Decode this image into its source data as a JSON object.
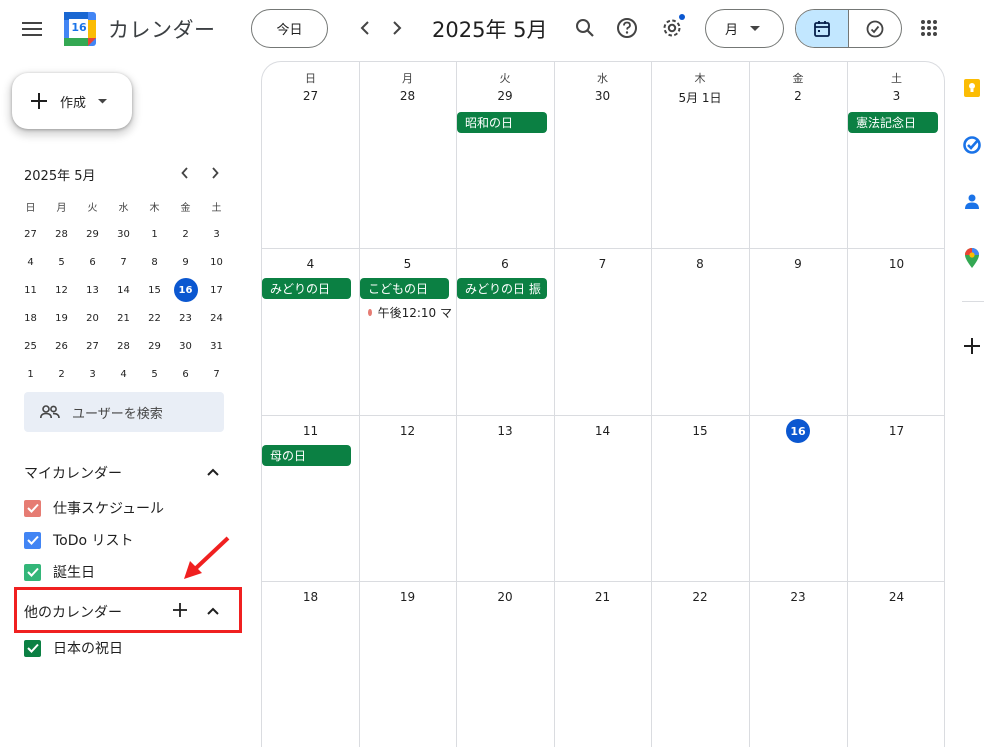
{
  "header": {
    "app_title": "カレンダー",
    "logo_number": "16",
    "today_label": "今日",
    "month_title": "2025年 5月",
    "view_label": "月",
    "colors": {
      "accent": "#0b57d0",
      "toggle_bg": "#c2e7ff"
    }
  },
  "sidebar": {
    "create_label": "作成",
    "mini_calendar": {
      "title": "2025年 5月",
      "weekdays": [
        "日",
        "月",
        "火",
        "水",
        "木",
        "金",
        "土"
      ],
      "weeks": [
        [
          "27",
          "28",
          "29",
          "30",
          "1",
          "2",
          "3"
        ],
        [
          "4",
          "5",
          "6",
          "7",
          "8",
          "9",
          "10"
        ],
        [
          "11",
          "12",
          "13",
          "14",
          "15",
          "16",
          "17"
        ],
        [
          "18",
          "19",
          "20",
          "21",
          "22",
          "23",
          "24"
        ],
        [
          "25",
          "26",
          "27",
          "28",
          "29",
          "30",
          "31"
        ],
        [
          "1",
          "2",
          "3",
          "4",
          "5",
          "6",
          "7"
        ]
      ],
      "today": "16"
    },
    "user_search_label": "ユーザーを検索",
    "my_calendars_title": "マイカレンダー",
    "my_calendars": [
      {
        "label": "仕事スケジュール",
        "color": "#e67c73"
      },
      {
        "label": "ToDo リスト",
        "color": "#4285f4"
      },
      {
        "label": "誕生日",
        "color": "#33b679"
      }
    ],
    "other_calendars_title": "他のカレンダー",
    "other_calendars": [
      {
        "label": "日本の祝日",
        "color": "#0b8043"
      }
    ]
  },
  "grid": {
    "weekdays": [
      "日",
      "月",
      "火",
      "水",
      "木",
      "金",
      "土"
    ],
    "weeks": [
      [
        "27",
        "28",
        "29",
        "30",
        "5月 1日",
        "2",
        "3"
      ],
      [
        "4",
        "5",
        "6",
        "7",
        "8",
        "9",
        "10"
      ],
      [
        "11",
        "12",
        "13",
        "14",
        "15",
        "16",
        "17"
      ],
      [
        "18",
        "19",
        "20",
        "21",
        "22",
        "23",
        "24"
      ]
    ],
    "today": "16",
    "events": {
      "showa": "昭和の日",
      "kenpo": "憲法記念日",
      "midori": "みどりの日",
      "kodomo": "こどもの日",
      "midori_furikae": "みどりの日 振",
      "timed_0505": "午後12:10 マ",
      "haha": "母の日"
    },
    "event_color": "#0b8043"
  }
}
